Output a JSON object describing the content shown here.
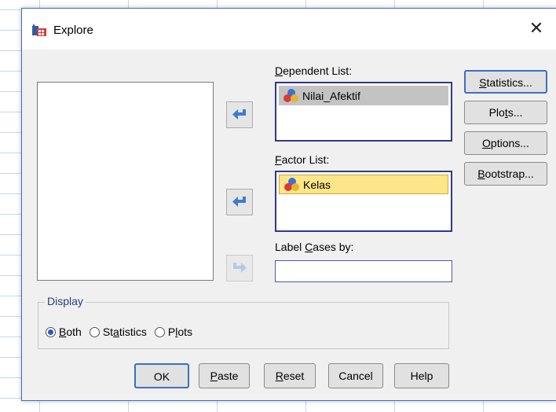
{
  "window": {
    "title": "Explore",
    "close_glyph": "✕"
  },
  "dependent_list": {
    "label_pre": "",
    "label_u": "D",
    "label_post": "ependent List:",
    "items": [
      {
        "name": "Nilai_Afektif",
        "icon": "scale-variable-icon"
      }
    ]
  },
  "factor_list": {
    "label_pre": "",
    "label_u": "F",
    "label_post": "actor List:",
    "items": [
      {
        "name": "Kelas",
        "icon": "scale-variable-icon"
      }
    ]
  },
  "label_cases": {
    "label_pre": "Label ",
    "label_u": "C",
    "label_post": "ases by:",
    "value": ""
  },
  "side_buttons": {
    "statistics": {
      "pre": "",
      "u": "S",
      "post": "tatistics..."
    },
    "plots": {
      "pre": "Plo",
      "u": "t",
      "post": "s..."
    },
    "options": {
      "pre": "",
      "u": "O",
      "post": "ptions..."
    },
    "bootstrap": {
      "pre": "",
      "u": "B",
      "post": "ootstrap..."
    }
  },
  "display": {
    "legend": "Display",
    "options": [
      {
        "pre": "",
        "u": "B",
        "post": "oth",
        "selected": true
      },
      {
        "pre": "St",
        "u": "a",
        "post": "tistics",
        "selected": false
      },
      {
        "pre": "P",
        "u": "l",
        "post": "ots",
        "selected": false
      }
    ]
  },
  "buttons": {
    "ok": "OK",
    "paste": {
      "pre": "",
      "u": "P",
      "post": "aste"
    },
    "reset": {
      "pre": "",
      "u": "R",
      "post": "eset"
    },
    "cancel": "Cancel",
    "help": "Help"
  },
  "colors": {
    "accent": "#3d6fbf",
    "factor_highlight": "#fde68a",
    "dependent_highlight": "#c3c3c3"
  }
}
